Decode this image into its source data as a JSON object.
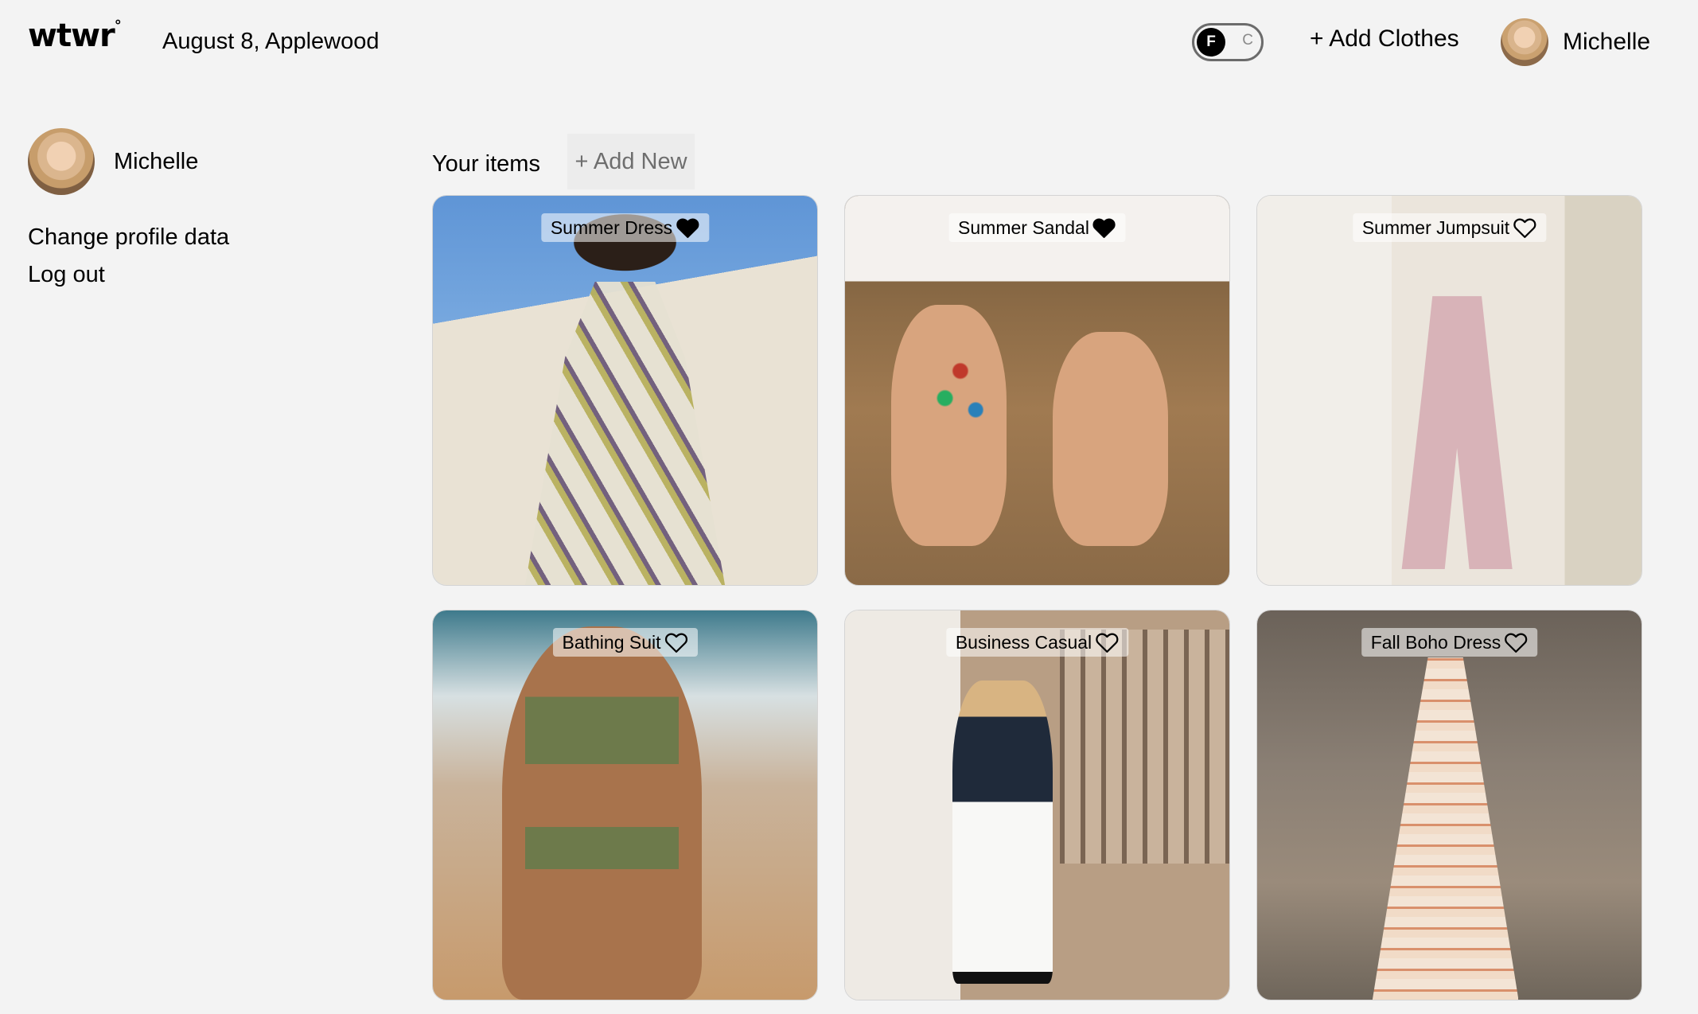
{
  "header": {
    "logo": "wtwr",
    "logo_mark": "°",
    "date_location": "August 8, Applewood",
    "toggle": {
      "on_label": "F",
      "off_label": "C",
      "selected": "F"
    },
    "add_clothes_label": "+ Add Clothes",
    "user_name": "Michelle"
  },
  "sidebar": {
    "user_name": "Michelle",
    "links": [
      "Change profile data",
      "Log out"
    ]
  },
  "main": {
    "section_title": "Your items",
    "add_new_label": "+ Add New",
    "items": [
      {
        "name": "Summer Dress",
        "liked": true
      },
      {
        "name": "Summer Sandal",
        "liked": true
      },
      {
        "name": "Summer Jumpsuit",
        "liked": false
      },
      {
        "name": "Bathing Suit",
        "liked": false
      },
      {
        "name": "Business Casual",
        "liked": false
      },
      {
        "name": "Fall Boho Dress",
        "liked": false
      }
    ]
  },
  "colors": {
    "background": "#f3f3f3",
    "text": "#000000",
    "muted": "#6e6e6e"
  }
}
